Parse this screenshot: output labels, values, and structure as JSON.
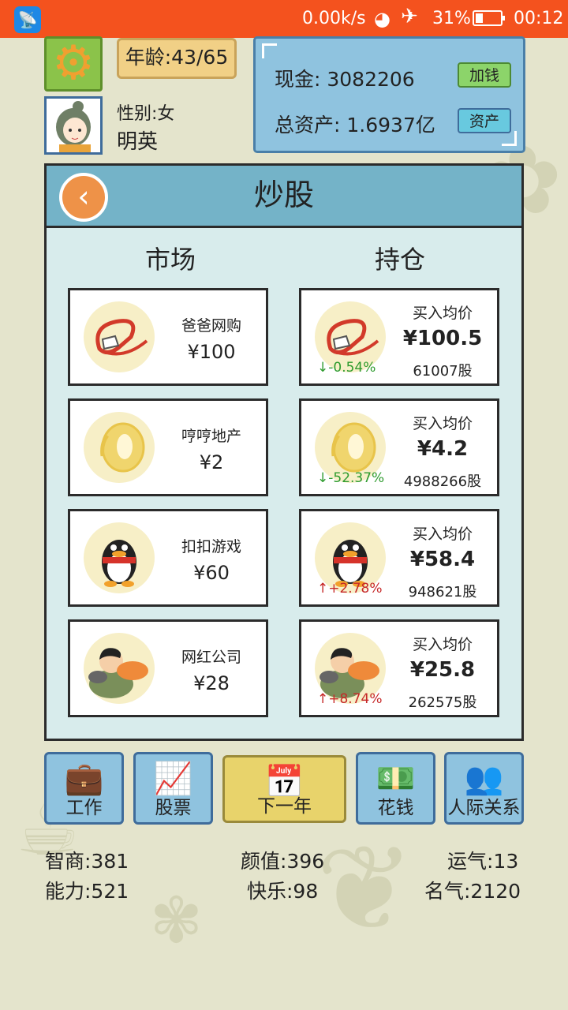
{
  "status_bar": {
    "speed": "0.00k/s",
    "battery": "31%",
    "battery_level": 0.31,
    "time": "00:12"
  },
  "player": {
    "age": "年龄:43/65",
    "gender": "性别:女",
    "name": "明英"
  },
  "finance": {
    "cash": "现金: 3082206",
    "add_money_label": "加钱",
    "total_assets": "总资产: 1.6937亿",
    "assets_label": "资产"
  },
  "panel": {
    "title": "炒股",
    "market_header": "市场",
    "holdings_header": "持仓"
  },
  "market": [
    {
      "name": "爸爸网购",
      "price": "¥100",
      "logo": "alibaba-like-logo"
    },
    {
      "name": "哼哼地产",
      "price": "¥2",
      "logo": "property-coin-logo"
    },
    {
      "name": "扣扣游戏",
      "price": "¥60",
      "logo": "penguin-logo"
    },
    {
      "name": "网红公司",
      "price": "¥28",
      "logo": "influencer-logo"
    }
  ],
  "holdings": [
    {
      "label": "买入均价",
      "price": "¥100.5",
      "shares": "61007股",
      "change": "↓-0.54%",
      "direction": "down"
    },
    {
      "label": "买入均价",
      "price": "¥4.2",
      "shares": "4988266股",
      "change": "↓-52.37%",
      "direction": "down"
    },
    {
      "label": "买入均价",
      "price": "¥58.4",
      "shares": "948621股",
      "change": "↑+2.78%",
      "direction": "up"
    },
    {
      "label": "买入均价",
      "price": "¥25.8",
      "shares": "262575股",
      "change": "↑+8.74%",
      "direction": "up"
    }
  ],
  "nav": [
    {
      "label": "工作",
      "icon": "briefcase-icon"
    },
    {
      "label": "股票",
      "icon": "stock-chart-icon"
    },
    {
      "label": "下一年",
      "icon": "calendar-icon"
    },
    {
      "label": "花钱",
      "icon": "money-icon"
    },
    {
      "label": "人际关系",
      "icon": "people-icon"
    }
  ],
  "stats": {
    "iq": "智商:381",
    "looks": "颜值:396",
    "luck": "运气:13",
    "ability": "能力:521",
    "happiness": "快乐:98",
    "fame": "名气:2120"
  },
  "colors": {
    "status_bar": "#f4521e",
    "panel_bg": "#d8ecec",
    "header_bg": "#74b3c8",
    "down": "#2e9b2e",
    "up": "#c62828"
  }
}
